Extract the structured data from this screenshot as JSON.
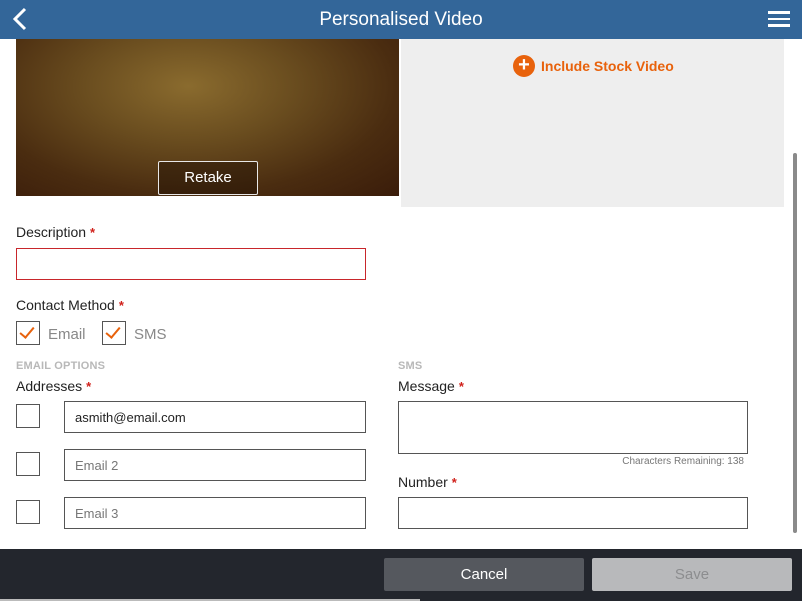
{
  "header": {
    "title": "Personalised Video",
    "back_icon": "chevron-left-icon",
    "menu_icon": "hamburger-menu-icon"
  },
  "video": {
    "retake_label": "Retake"
  },
  "stock": {
    "label": "Include Stock Video",
    "icon": "plus-circle-icon"
  },
  "description": {
    "label": "Description",
    "required": "*",
    "value": ""
  },
  "contact_method": {
    "label": "Contact Method",
    "required": "*",
    "options": [
      {
        "label": "Email",
        "checked": true
      },
      {
        "label": "SMS",
        "checked": true
      }
    ]
  },
  "email_options": {
    "heading": "EMAIL OPTIONS",
    "addresses_label": "Addresses",
    "required": "*",
    "fields": [
      {
        "value": "asmith@email.com",
        "placeholder": "",
        "checked": false
      },
      {
        "value": "",
        "placeholder": "Email 2",
        "checked": false
      },
      {
        "value": "",
        "placeholder": "Email 3",
        "checked": false
      }
    ]
  },
  "sms": {
    "heading": "SMS",
    "message_label": "Message",
    "required": "*",
    "chars_remaining": "Characters Remaining: 138",
    "number_label": "Number"
  },
  "footer": {
    "cancel_label": "Cancel",
    "save_label": "Save"
  },
  "colors": {
    "header": "#336699",
    "accent": "#e8620c",
    "error": "#c8262b",
    "footer": "#23262d"
  }
}
